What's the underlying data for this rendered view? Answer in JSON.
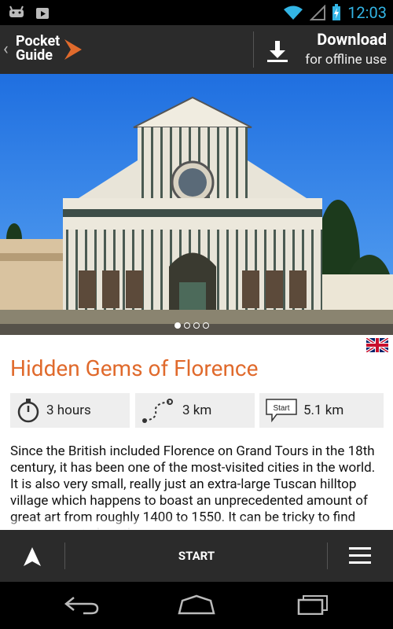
{
  "status": {
    "time": "12:03"
  },
  "appbar": {
    "logo_line1": "Pocket",
    "logo_line2": "Guide",
    "download_title": "Download",
    "download_subtitle": "for offline use"
  },
  "carousel": {
    "current": 1,
    "total": 4
  },
  "tour": {
    "title": "Hidden Gems of Florence",
    "duration": "3 hours",
    "distance": "3 km",
    "start_badge": "Start",
    "start_distance": "5.1 km",
    "description": "Since the British included Florence on Grand Tours in the 18th century, it has been one of the most-visited cities in the world.  It is also very small, really just an extra-large Tuscan hilltop village which happens to boast an unprecedented amount of great art from roughly 1400 to 1550.  It can be tricky to find some room to breathe"
  },
  "bottombar": {
    "start_label": "START"
  },
  "colors": {
    "accent": "#e06a2c",
    "bar": "#2b2b2b",
    "time": "#33b5e5"
  }
}
